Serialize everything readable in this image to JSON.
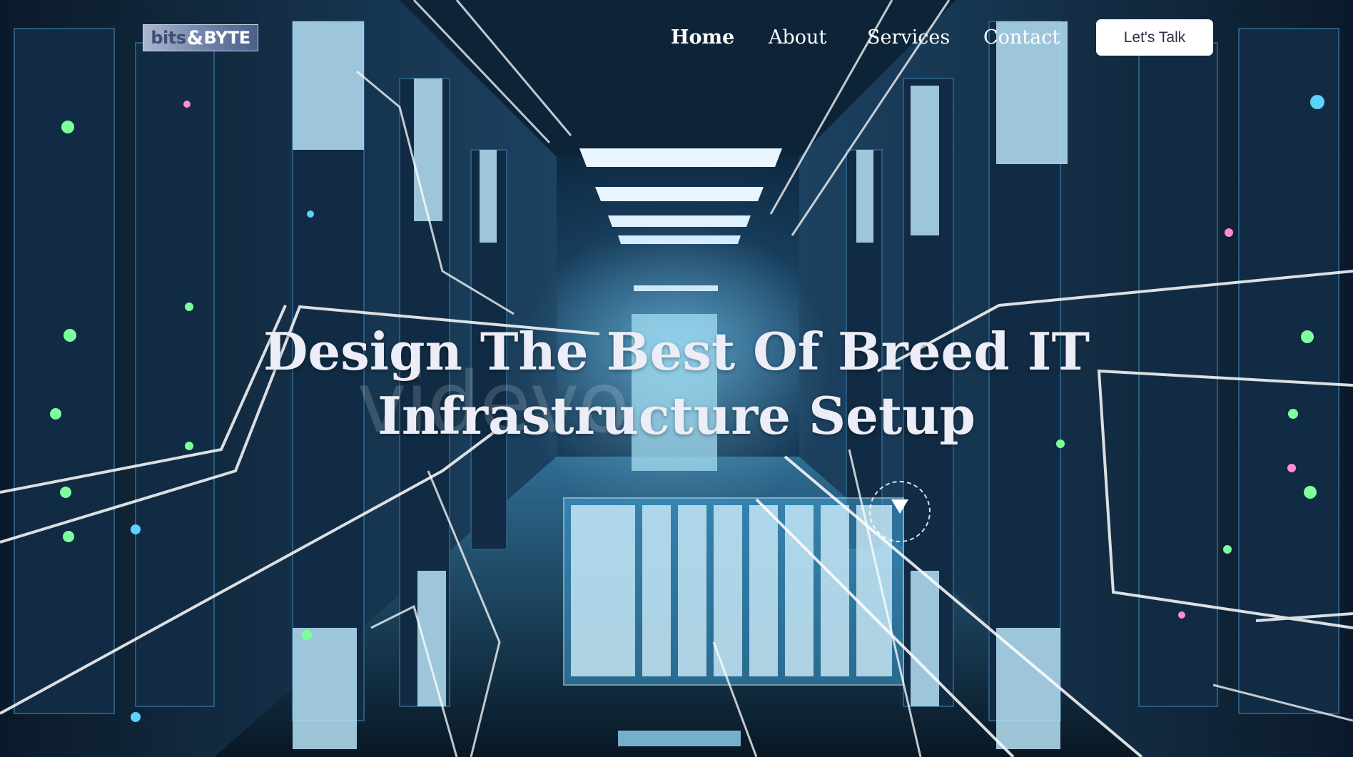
{
  "brand": {
    "logo_part1": "bits",
    "logo_amp": "&",
    "logo_part2": "BYTE"
  },
  "nav": {
    "items": [
      {
        "label": "Home",
        "active": true
      },
      {
        "label": "About",
        "active": false
      },
      {
        "label": "Services",
        "active": false
      },
      {
        "label": "Contact",
        "active": false
      }
    ],
    "cta_label": "Let's Talk"
  },
  "hero": {
    "headline_line1": "Design The Best Of Breed IT",
    "headline_line2": "Infrastructure Setup",
    "background": "server-room-video",
    "watermark": "videvo",
    "play_icon": "play-circle-icon"
  },
  "colors": {
    "text": "#ffffff",
    "headline": "#ecedf6",
    "cta_bg": "#ffffff",
    "cta_text": "#2b2f45",
    "background": "#0a2035"
  }
}
